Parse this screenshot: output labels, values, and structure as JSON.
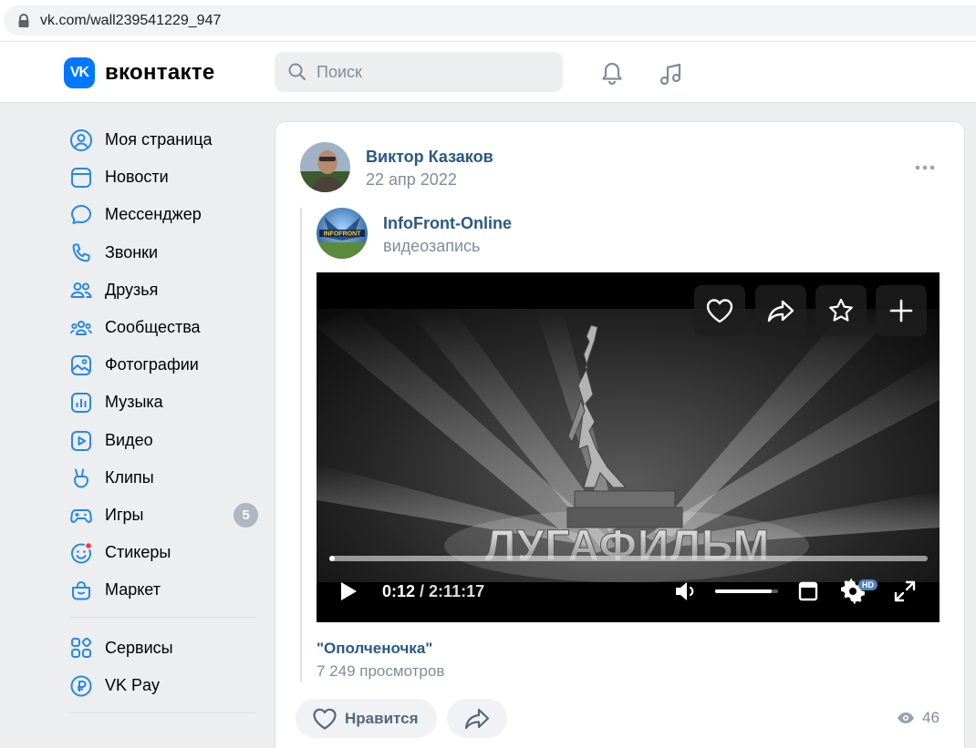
{
  "browser": {
    "url": "vk.com/wall239541229_947"
  },
  "header": {
    "logo_badge": "VK",
    "logo_text": "вконтакте",
    "search_placeholder": "Поиск"
  },
  "sidebar": {
    "items": [
      {
        "label": "Моя страница",
        "icon": "user-circle-icon"
      },
      {
        "label": "Новости",
        "icon": "news-icon"
      },
      {
        "label": "Мессенджер",
        "icon": "message-icon"
      },
      {
        "label": "Звонки",
        "icon": "phone-icon"
      },
      {
        "label": "Друзья",
        "icon": "friends-icon"
      },
      {
        "label": "Сообщества",
        "icon": "communities-icon"
      },
      {
        "label": "Фотографии",
        "icon": "photos-icon"
      },
      {
        "label": "Музыка",
        "icon": "music-icon"
      },
      {
        "label": "Видео",
        "icon": "video-icon"
      },
      {
        "label": "Клипы",
        "icon": "clips-icon"
      },
      {
        "label": "Игры",
        "icon": "games-icon",
        "badge": "5"
      },
      {
        "label": "Стикеры",
        "icon": "stickers-icon"
      },
      {
        "label": "Маркет",
        "icon": "market-icon"
      }
    ],
    "secondary": [
      {
        "label": "Сервисы",
        "icon": "services-icon"
      },
      {
        "label": "VK Pay",
        "icon": "vkpay-icon"
      }
    ]
  },
  "post": {
    "author": "Виктор Казаков",
    "date": "22 апр 2022",
    "source_name": "InfoFront-Online",
    "source_type": "видеозапись",
    "source_avatar_text": "INFOFRONT"
  },
  "video": {
    "overlay_text": "ЛУГАФИЛЬМ",
    "current_time": "0:12",
    "separator": " / ",
    "duration": "2:11:17",
    "progress": 0.0015,
    "volume": 0.9,
    "quality_badge": "HD",
    "title": "\"Ополченочка\"",
    "views": "7 249 просмотров"
  },
  "actions": {
    "like_label": "Нравится",
    "views_count": "46"
  },
  "colors": {
    "accent": "#0077ff",
    "link": "#2a5885",
    "muted": "#818c99",
    "background": "#edeef0"
  }
}
